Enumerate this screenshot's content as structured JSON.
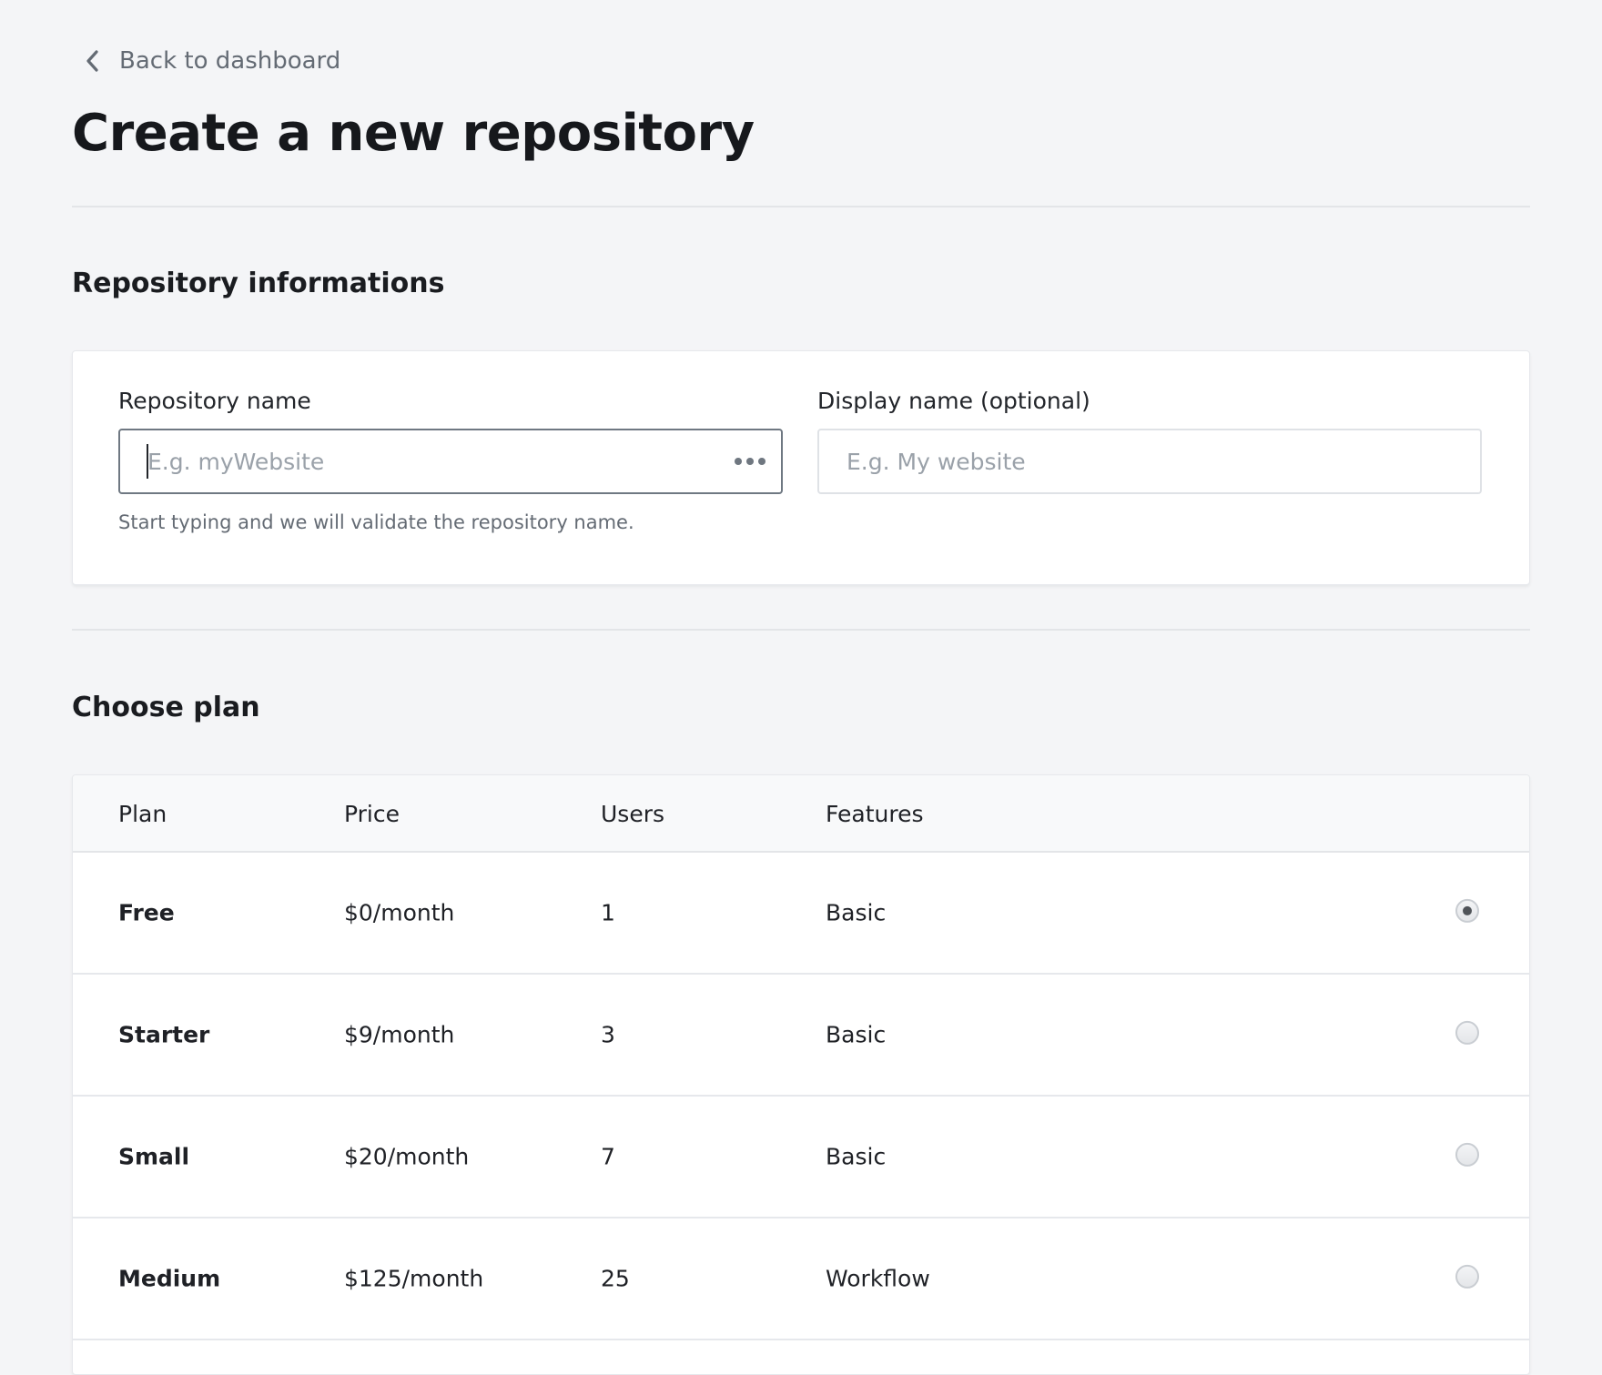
{
  "nav": {
    "back_label": "Back to dashboard",
    "back_icon": "chevron-left-icon"
  },
  "page": {
    "title": "Create a new repository"
  },
  "repository_info": {
    "section_title": "Repository informations",
    "repo_name": {
      "label": "Repository name",
      "placeholder": "E.g. myWebsite",
      "value": "",
      "hint": "Start typing and we will validate the repository name.",
      "status_icon": "ellipsis-icon"
    },
    "display_name": {
      "label": "Display name (optional)",
      "placeholder": "E.g. My website",
      "value": ""
    }
  },
  "plans": {
    "section_title": "Choose plan",
    "columns": [
      "Plan",
      "Price",
      "Users",
      "Features"
    ],
    "rows": [
      {
        "plan": "Free",
        "price": "$0/month",
        "users": "1",
        "features": "Basic",
        "selected": true
      },
      {
        "plan": "Starter",
        "price": "$9/month",
        "users": "3",
        "features": "Basic",
        "selected": false
      },
      {
        "plan": "Small",
        "price": "$20/month",
        "users": "7",
        "features": "Basic",
        "selected": false
      },
      {
        "plan": "Medium",
        "price": "$125/month",
        "users": "25",
        "features": "Workflow",
        "selected": false
      }
    ]
  },
  "colors": {
    "background": "#f4f5f7",
    "card": "#ffffff",
    "text": "#1f2126",
    "muted": "#646b74",
    "border": "#e3e5e8"
  }
}
